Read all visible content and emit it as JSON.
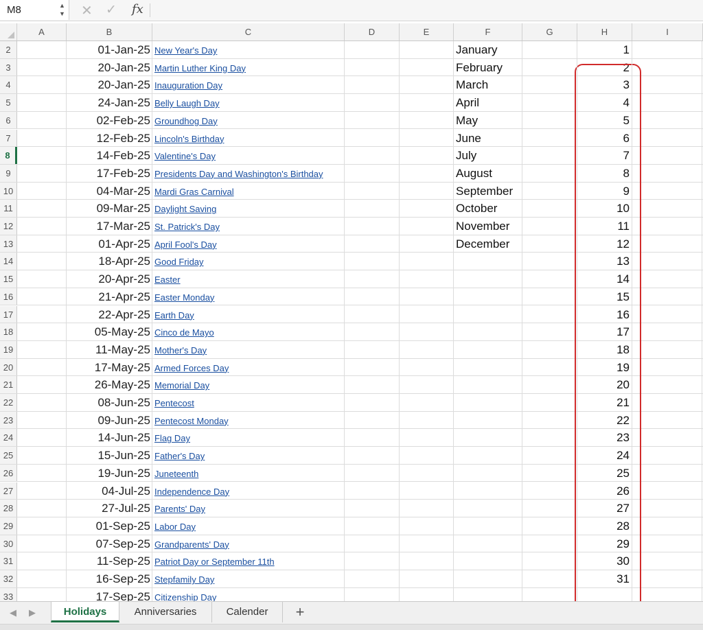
{
  "formula_bar": {
    "name_box": "M8",
    "stepper_up": "▲",
    "stepper_down": "▼",
    "cancel_glyph": "✕",
    "confirm_glyph": "✓",
    "fx_label": "fx"
  },
  "columns": [
    "A",
    "B",
    "C",
    "D",
    "E",
    "F",
    "G",
    "H",
    "I"
  ],
  "active_row": "8",
  "rows": [
    {
      "row": "2",
      "date": "01-Jan-25",
      "holiday": "New Year's Day",
      "month": "January",
      "day": "1"
    },
    {
      "row": "3",
      "date": "20-Jan-25",
      "holiday": "Martin Luther King Day",
      "month": "February",
      "day": "2"
    },
    {
      "row": "4",
      "date": "20-Jan-25",
      "holiday": "Inauguration Day",
      "month": "March",
      "day": "3"
    },
    {
      "row": "5",
      "date": "24-Jan-25",
      "holiday": "Belly Laugh Day",
      "month": "April",
      "day": "4"
    },
    {
      "row": "6",
      "date": "02-Feb-25",
      "holiday": "Groundhog Day",
      "month": "May",
      "day": "5"
    },
    {
      "row": "7",
      "date": "12-Feb-25",
      "holiday": "Lincoln's Birthday",
      "month": "June",
      "day": "6"
    },
    {
      "row": "8",
      "date": "14-Feb-25",
      "holiday": "Valentine's Day",
      "month": "July",
      "day": "7"
    },
    {
      "row": "9",
      "date": "17-Feb-25",
      "holiday": "Presidents Day and Washington's Birthday",
      "month": "August",
      "day": "8"
    },
    {
      "row": "10",
      "date": "04-Mar-25",
      "holiday": "Mardi Gras Carnival",
      "month": "September",
      "day": "9"
    },
    {
      "row": "11",
      "date": "09-Mar-25",
      "holiday": "Daylight Saving",
      "month": "October",
      "day": "10"
    },
    {
      "row": "12",
      "date": "17-Mar-25",
      "holiday": "St. Patrick's Day",
      "month": "November",
      "day": "11"
    },
    {
      "row": "13",
      "date": "01-Apr-25",
      "holiday": "April Fool's Day",
      "month": "December",
      "day": "12"
    },
    {
      "row": "14",
      "date": "18-Apr-25",
      "holiday": "Good Friday",
      "month": "",
      "day": "13"
    },
    {
      "row": "15",
      "date": "20-Apr-25",
      "holiday": "Easter",
      "month": "",
      "day": "14"
    },
    {
      "row": "16",
      "date": "21-Apr-25",
      "holiday": "Easter Monday",
      "month": "",
      "day": "15"
    },
    {
      "row": "17",
      "date": "22-Apr-25",
      "holiday": "Earth Day",
      "month": "",
      "day": "16"
    },
    {
      "row": "18",
      "date": "05-May-25",
      "holiday": "Cinco de Mayo",
      "month": "",
      "day": "17"
    },
    {
      "row": "19",
      "date": "11-May-25",
      "holiday": "Mother's Day",
      "month": "",
      "day": "18"
    },
    {
      "row": "20",
      "date": "17-May-25",
      "holiday": "Armed Forces Day",
      "month": "",
      "day": "19"
    },
    {
      "row": "21",
      "date": "26-May-25",
      "holiday": "Memorial Day",
      "month": "",
      "day": "20"
    },
    {
      "row": "22",
      "date": "08-Jun-25",
      "holiday": "Pentecost",
      "month": "",
      "day": "21"
    },
    {
      "row": "23",
      "date": "09-Jun-25",
      "holiday": "Pentecost Monday",
      "month": "",
      "day": "22"
    },
    {
      "row": "24",
      "date": "14-Jun-25",
      "holiday": "Flag Day",
      "month": "",
      "day": "23"
    },
    {
      "row": "25",
      "date": "15-Jun-25",
      "holiday": "Father's Day",
      "month": "",
      "day": "24"
    },
    {
      "row": "26",
      "date": "19-Jun-25",
      "holiday": "Juneteenth",
      "month": "",
      "day": "25"
    },
    {
      "row": "27",
      "date": "04-Jul-25",
      "holiday": "Independence Day",
      "month": "",
      "day": "26"
    },
    {
      "row": "28",
      "date": "27-Jul-25",
      "holiday": "Parents' Day",
      "month": "",
      "day": "27"
    },
    {
      "row": "29",
      "date": "01-Sep-25",
      "holiday": "Labor Day",
      "month": "",
      "day": "28"
    },
    {
      "row": "30",
      "date": "07-Sep-25",
      "holiday": "Grandparents' Day",
      "month": "",
      "day": "29"
    },
    {
      "row": "31",
      "date": "11-Sep-25",
      "holiday": "Patriot Day or September 11th",
      "month": "",
      "day": "30"
    },
    {
      "row": "32",
      "date": "16-Sep-25",
      "holiday": "Stepfamily Day",
      "month": "",
      "day": "31"
    },
    {
      "row": "33",
      "date": "17-Sep-25",
      "holiday": "Citizenship Day",
      "month": "",
      "day": ""
    }
  ],
  "sheet_tabs": {
    "nav_prev": "◀",
    "nav_next": "▶",
    "tabs": [
      "Holidays",
      "Anniversaries",
      "Calender"
    ],
    "active": "Holidays",
    "add_label": "+"
  },
  "colors": {
    "active_tab": "#1e7145",
    "hyperlink": "#1a4fa0",
    "highlight_border": "#d12b2b"
  }
}
